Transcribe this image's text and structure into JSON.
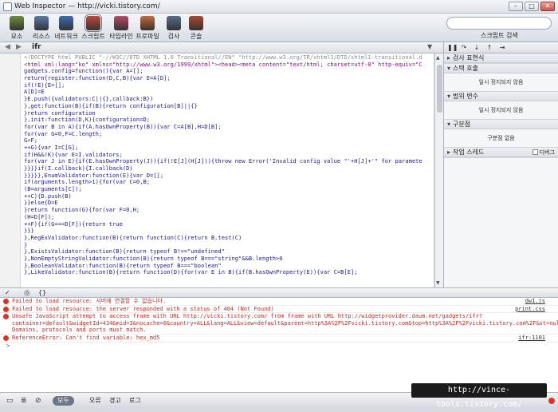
{
  "window": {
    "title": "Web Inspector — http://vicki.tistory.com/"
  },
  "toolbar": {
    "items": [
      {
        "label": "요소",
        "icon": "elements-icon",
        "color": "#6c8f3a"
      },
      {
        "label": "리소스",
        "icon": "resources-icon",
        "color": "#5a7ba8"
      },
      {
        "label": "네트워크",
        "icon": "network-icon",
        "color": "#3a6fb0"
      },
      {
        "label": "스크립트",
        "icon": "scripts-icon",
        "color": "#c24a3a"
      },
      {
        "label": "타임라인",
        "icon": "timeline-icon",
        "color": "#b94b6a"
      },
      {
        "label": "프로파일",
        "icon": "profiles-icon",
        "color": "#c96a3b"
      },
      {
        "label": "검사",
        "icon": "audits-icon",
        "color": "#5a6e8a"
      },
      {
        "label": "콘솔",
        "icon": "console-icon",
        "color": "#a94a2f"
      }
    ],
    "search_label": "스크립트 검색"
  },
  "editor": {
    "file": "ifr",
    "lines": [
      "<!DOCTYPE html PUBLIC \"-//W3C//DTD XHTML 1.0 Transitional//EN\" \"http://www.w3.org/TR/xhtml1/DTD/xhtml1-transitional.d",
      "<html xml:lang=\"ko\" xmlns=\"http://www.w3.org/1999/xhtml\"><head><meta content=\"text/html; charset=utf-8\" http-equiv=\"C",
      "gadgets.config=function(){var A=[];",
      "return{register:function(D,C,B){var E=A[D];",
      "if(!E){E=[];",
      "A[D]=E",
      "}E.push({validators:C||{},callback:B})",
      "},get:function(B){if(B){return configuration[B]||{}",
      "}return configuration",
      "},init:function(D,K){configuration=D;",
      "for(var B in A){if(A.hasOwnProperty(B)){var C=A[B],H=D[B];",
      "for(var G=0,F=C.length;",
      "G<F;",
      "++G){var I=C[G];",
      "if(H&&!K){var E=I.validators;",
      "for(var J in E){if(E.hasOwnProperty(J)){if(!E[J](H[J])){throw new Error('Invalid config value \"'+H[J]+'\" for paramete",
      "}}}}if(I.callback){I.callback(D)",
      "}}}}},EnumValidator:function(E){var D=[];",
      "if(arguments.length>1){for(var C=0,B;",
      "(B=arguments[C]);",
      "++C){D.push(B)",
      "}}else{D=E",
      "}return function(G){for(var F=0,H;",
      "(H=D[F]);",
      "++F){if(G===D[F]){return true",
      "}}}",
      "},RegExValidator:function(B){return function(C){return B.test(C)",
      "}",
      "},ExistsValidator:function(B){return typeof B!==\"undefined\"",
      "},NonEmptyStringValidator:function(B){return typeof B===\"string\"&&B.length>0",
      "},BooleanValidator:function(B){return typeof B===\"boolean\"",
      "},LikeValidator:function(B){return function(D){for(var E in B){if(B.hasOwnProperty(E)){var C=B[E];"
    ]
  },
  "sidebar": {
    "sections": [
      {
        "title": "검사 표현식",
        "open": false,
        "body": ""
      },
      {
        "title": "스택 호출",
        "open": true,
        "body": "일시 정지되지 않음"
      },
      {
        "title": "범위 변수",
        "open": true,
        "body": "일시 정지되지 않음"
      },
      {
        "title": "구분점",
        "open": true,
        "body": "구분점 없음"
      },
      {
        "title": "작업 스레드",
        "open": false,
        "body": "",
        "checkbox_label": "디버그"
      }
    ]
  },
  "console": {
    "messages": [
      {
        "text": "Failed to load resource: 서버에 연결할 수 없습니다.",
        "source": "dw1.js"
      },
      {
        "text": "Failed to load resource: the server responded with a status of 404 (Not Found)",
        "source": "print.css"
      },
      {
        "text": "Unsafe JavaScript attempt to access frame with URL http://vicki.tistory.com/ from frame with URL http://widgetprovider.daum.net/gadgets/ifr?container=default&widgetId=434&mid=3&nocache=0&country=ALL&lang=ALL&view=default&parent=http%3A%2F%2Fvicki.tistory.com&top=http%3A%2F%2Fvicki.tistory.com%2F&st=null%3Anull%3Anull%3Anull%3Ahttp%253A//widgetcfs1.daum.net/xml/15/widget/2009/07/22/17/20/4a66cbbacfa56.xml%3A434%3Anull&url=http%3A%2F%2Fwidgetcfs1.daum.net%2Fxml%2F15%2Fwidget%2F2009%2F07%2F22%2F17%2F20%2F4a66cbbacfa56.xml&v=pcToken=603979150&url=http://widgetcfs1.daum.net/xml/15/widget/2009/07/22/17/20/4a66cbbacfa56.xml&scrap=1&widgetId=434&title=Daum+view+%EB%9E%AD%ED%82%B9%EC%9C%84%EC%A0%AF&height=155&up_DAUM_WIDGETBANK_BLOG_URL=http%3A%2F%2Fvicki.tistory.com&up_init_pan=0&width=166&border=simple&. Domains, protocols and ports must match.",
        "source": ""
      },
      {
        "text": "ReferenceError: Can't find variable: hex_md5",
        "source": "ifr:1101"
      }
    ],
    "prompt": ">"
  },
  "bottombar": {
    "filters": [
      "모두",
      "오류",
      "경고",
      "로그"
    ],
    "selected": "모두"
  },
  "watermark": "http://vince-tools.tistory.com/"
}
